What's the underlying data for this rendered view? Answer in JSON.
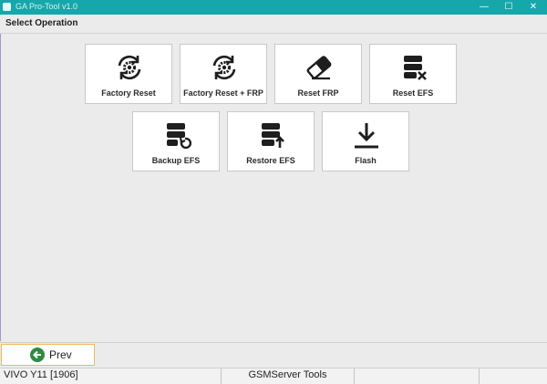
{
  "window": {
    "title": "GA Pro-Tool v1.0",
    "minimize_glyph": "—",
    "maximize_glyph": "☐",
    "close_glyph": "✕"
  },
  "header": {
    "title": "Select Operation"
  },
  "operations": [
    {
      "label": "Factory Reset",
      "icon": "settings-sync-icon"
    },
    {
      "label": "Factory Reset + FRP",
      "icon": "settings-sync-icon"
    },
    {
      "label": "Reset FRP",
      "icon": "eraser-icon"
    },
    {
      "label": "Reset EFS",
      "icon": "database-x-icon"
    },
    {
      "label": "Backup EFS",
      "icon": "database-backup-icon"
    },
    {
      "label": "Restore EFS",
      "icon": "database-upload-icon"
    },
    {
      "label": "Flash",
      "icon": "download-icon"
    }
  ],
  "footer": {
    "prev_label": "Prev",
    "prev_icon": "back-arrow-icon",
    "accent_color": "#2e8b3e"
  },
  "statusbar": {
    "device": "VIVO Y11 [1906]",
    "brand": "GSMServer Tools",
    "slot3": "",
    "slot4": ""
  },
  "colors": {
    "titlebar": "#16a7ab",
    "background": "#ebebeb",
    "button_bg": "#ffffff",
    "prev_border": "#f0b85a"
  }
}
